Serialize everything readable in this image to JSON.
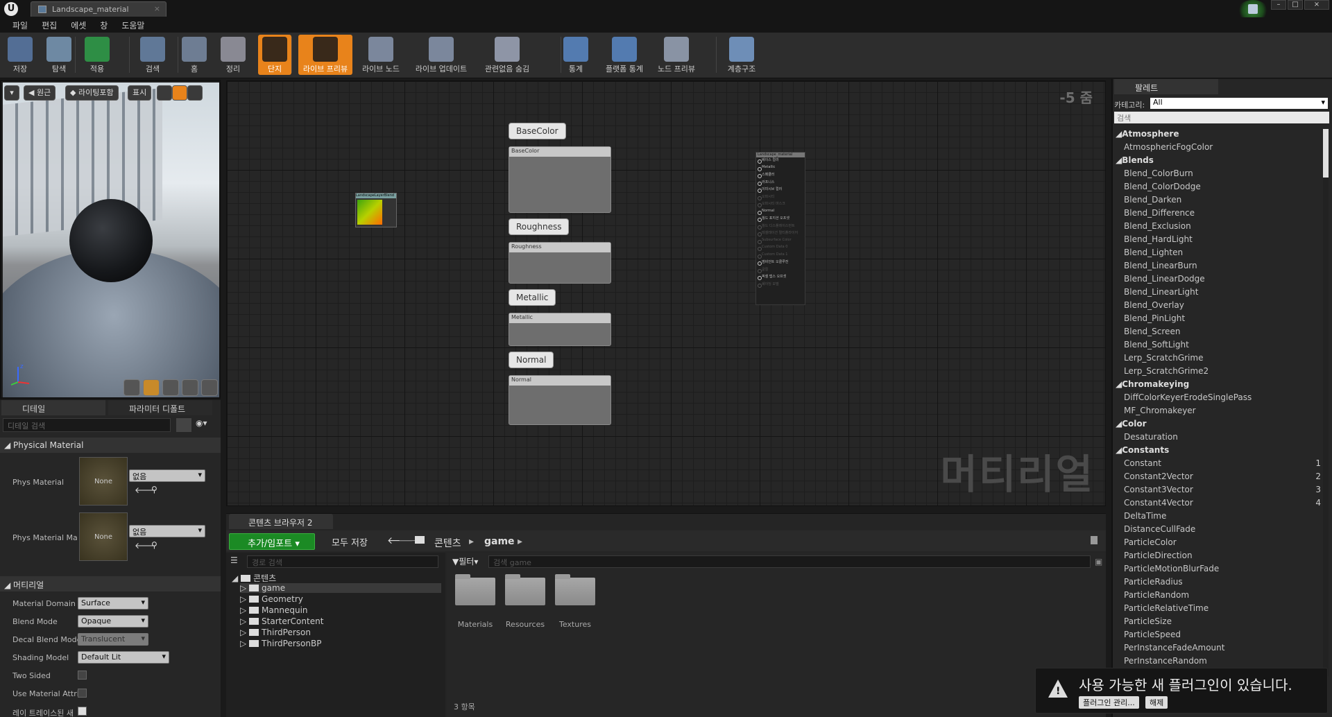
{
  "window": {
    "tab_title": "Landscape_material"
  },
  "menu": [
    "파일",
    "편집",
    "에셋",
    "창",
    "도움말"
  ],
  "toolbar": [
    {
      "label": "저장",
      "icon": "save-icon"
    },
    {
      "label": "탐색",
      "icon": "browse-icon"
    },
    {
      "label": "적용",
      "icon": "apply-icon"
    },
    {
      "label": "검색",
      "icon": "search-icon"
    },
    {
      "label": "홈",
      "icon": "home-icon"
    },
    {
      "label": "정리",
      "icon": "clean-icon"
    },
    {
      "label": "단지",
      "icon": "connectors-icon",
      "active": true
    },
    {
      "label": "라이브 프리뷰",
      "icon": "live-preview-icon",
      "active": true
    },
    {
      "label": "라이브 노드",
      "icon": "live-nodes-icon"
    },
    {
      "label": "라이브 업데이트",
      "icon": "live-update-icon"
    },
    {
      "label": "관련없음 숨김",
      "icon": "hide-unrelated-icon"
    },
    {
      "label": "통계",
      "icon": "stats-icon"
    },
    {
      "label": "플랫폼 통계",
      "icon": "platform-stats-icon"
    },
    {
      "label": "노드 프리뷰",
      "icon": "node-preview-icon"
    },
    {
      "label": "계층구조",
      "icon": "hierarchy-icon"
    }
  ],
  "viewport": {
    "perspective": "원근",
    "lighting": "라이팅포함",
    "show": "표시"
  },
  "details": {
    "tab1": "디테일",
    "tab2": "파라미터 디폴트",
    "search_placeholder": "디테일 검색",
    "physical_section": "Physical Material",
    "phys_label1": "Phys Material",
    "phys_label2": "Phys Material Ma",
    "none": "None",
    "phys_value": "없음",
    "material_section": "머티리얼",
    "props": [
      {
        "label": "Material Domain",
        "value": "Surface"
      },
      {
        "label": "Blend Mode",
        "value": "Opaque"
      },
      {
        "label": "Decal Blend Mode",
        "value": "Translucent"
      },
      {
        "label": "Shading Model",
        "value": "Default Lit"
      },
      {
        "label": "Two Sided",
        "value": ""
      },
      {
        "label": "Use Material Attri",
        "value": ""
      },
      {
        "label": "레이 트레이스된 새",
        "value": ""
      }
    ]
  },
  "graph": {
    "zoom": "-5 줌",
    "watermark": "머티리얼",
    "layer_node": "LandscapeLayerBlend",
    "result_node": "Landscape_material",
    "params": [
      {
        "bubble": "BaseColor",
        "name": "BaseColor"
      },
      {
        "bubble": "Roughness",
        "name": "Roughness"
      },
      {
        "bubble": "Metallic",
        "name": "Metallic"
      },
      {
        "bubble": "Normal",
        "name": "Normal"
      }
    ],
    "result_pins": [
      "베이스 컬러",
      "Metallic",
      "스페큘러",
      "러프니스",
      "이미시브 컬러",
      "오파시티",
      "오파시티 마스크",
      "Normal",
      "월드 포지션 오프셋",
      "월드 디스플레이스먼트",
      "테셀레이션 멀티플라이어",
      "Subsurface Color",
      "Custom Data 0",
      "Custom Data 1",
      "앰비언트 오클루전",
      "굴절",
      "픽셀 뎁스 오프셋",
      "쉐이딩 모델"
    ],
    "result_pins_dim": [
      false,
      false,
      false,
      false,
      false,
      true,
      true,
      false,
      false,
      true,
      true,
      true,
      true,
      true,
      false,
      true,
      false,
      true
    ]
  },
  "content_browser": {
    "tab": "콘텐츠 브라우저 2",
    "add_import": "추가/임포트",
    "save_all": "모두 저장",
    "crumb_root": "콘텐츠",
    "crumb_game": "game",
    "path_search": "경로 검색",
    "tree_root": "콘텐츠",
    "tree": [
      "game",
      "Geometry",
      "Mannequin",
      "StarterContent",
      "ThirdPerson",
      "ThirdPersonBP"
    ],
    "filter": "필터",
    "search_placeholder": "검색 game",
    "folders": [
      "Materials",
      "Resources",
      "Textures"
    ],
    "count": "3 항목"
  },
  "palette": {
    "tab": "팔레트",
    "category_label": "카테고리:",
    "category_value": "All",
    "search_placeholder": "검색",
    "items": [
      {
        "t": "Atmosphere",
        "cat": true
      },
      {
        "t": "AtmosphericFogColor"
      },
      {
        "t": "Blends",
        "cat": true
      },
      {
        "t": "Blend_ColorBurn"
      },
      {
        "t": "Blend_ColorDodge"
      },
      {
        "t": "Blend_Darken"
      },
      {
        "t": "Blend_Difference"
      },
      {
        "t": "Blend_Exclusion"
      },
      {
        "t": "Blend_HardLight"
      },
      {
        "t": "Blend_Lighten"
      },
      {
        "t": "Blend_LinearBurn"
      },
      {
        "t": "Blend_LinearDodge"
      },
      {
        "t": "Blend_LinearLight"
      },
      {
        "t": "Blend_Overlay"
      },
      {
        "t": "Blend_PinLight"
      },
      {
        "t": "Blend_Screen"
      },
      {
        "t": "Blend_SoftLight"
      },
      {
        "t": "Lerp_ScratchGrime"
      },
      {
        "t": "Lerp_ScratchGrime2"
      },
      {
        "t": "Chromakeying",
        "cat": true
      },
      {
        "t": "DiffColorKeyerErodeSinglePass"
      },
      {
        "t": "MF_Chromakeyer"
      },
      {
        "t": "Color",
        "cat": true
      },
      {
        "t": "Desaturation"
      },
      {
        "t": "Constants",
        "cat": true
      },
      {
        "t": "Constant",
        "sc": "1"
      },
      {
        "t": "Constant2Vector",
        "sc": "2"
      },
      {
        "t": "Constant3Vector",
        "sc": "3"
      },
      {
        "t": "Constant4Vector",
        "sc": "4"
      },
      {
        "t": "DeltaTime"
      },
      {
        "t": "DistanceCullFade"
      },
      {
        "t": "ParticleColor"
      },
      {
        "t": "ParticleDirection"
      },
      {
        "t": "ParticleMotionBlurFade"
      },
      {
        "t": "ParticleRadius"
      },
      {
        "t": "ParticleRandom"
      },
      {
        "t": "ParticleRelativeTime"
      },
      {
        "t": "ParticleSize"
      },
      {
        "t": "ParticleSpeed"
      },
      {
        "t": "PerInstanceFadeAmount"
      },
      {
        "t": "PerInstanceRandom"
      }
    ]
  },
  "toast": {
    "message": "사용 가능한 새 플러그인이 있습니다.",
    "manage": "플러그인 관리...",
    "dismiss": "해제"
  }
}
